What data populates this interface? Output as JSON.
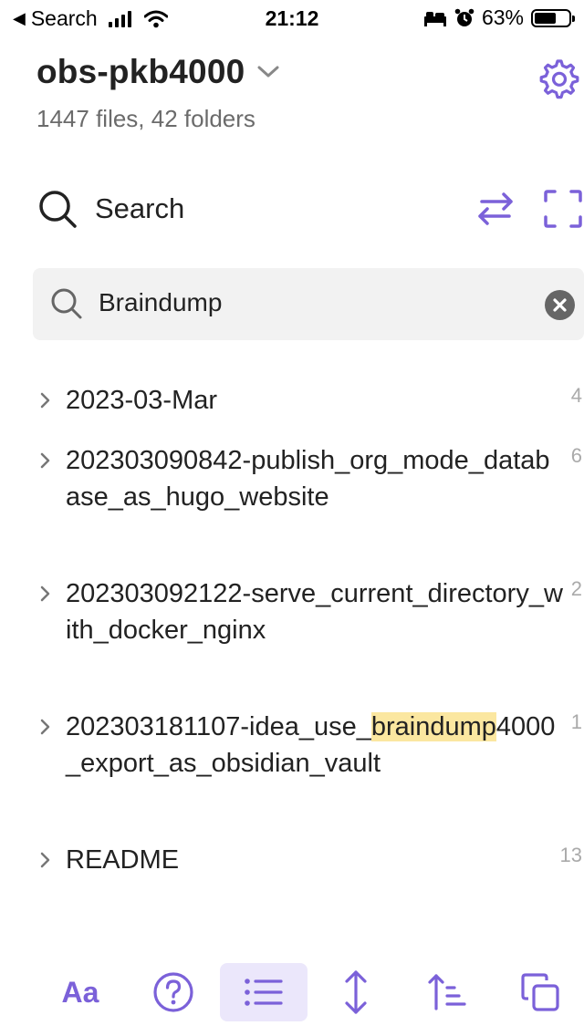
{
  "status_bar": {
    "back_app": "Search",
    "time": "21:12",
    "battery_percent": "63%",
    "battery_level": 0.63
  },
  "header": {
    "vault_name": "obs-pkb4000",
    "vault_stats": "1447 files, 42 folders"
  },
  "search_panel": {
    "title": "Search",
    "query": "Braindump"
  },
  "results": [
    {
      "name_before": "2023-03-Mar",
      "highlight": "",
      "name_after": "",
      "count": "4"
    },
    {
      "name_before": "202303090842-publish_org_mode_database_as_hugo_website",
      "highlight": "",
      "name_after": "",
      "count": "6"
    },
    {
      "name_before": "202303092122-serve_current_directory_with_docker_nginx",
      "highlight": "",
      "name_after": "",
      "count": "2"
    },
    {
      "name_before": "202303181107-idea_use_",
      "highlight": "braindump",
      "name_after": "4000_export_as_obsidian_vault",
      "count": "1"
    },
    {
      "name_before": "README",
      "highlight": "",
      "name_after": "",
      "count": "13"
    }
  ],
  "toolbar": {
    "font_label": "Aa",
    "icons": [
      "font-icon",
      "help-icon",
      "list-icon",
      "expand-vertical-icon",
      "sort-icon",
      "copy-icon"
    ],
    "active": "list-icon"
  },
  "colors": {
    "accent": "#7b61d9",
    "highlight": "#fbe7a0",
    "search_box_bg": "#f2f2f2",
    "active_tab_bg": "#ebe7fb"
  }
}
